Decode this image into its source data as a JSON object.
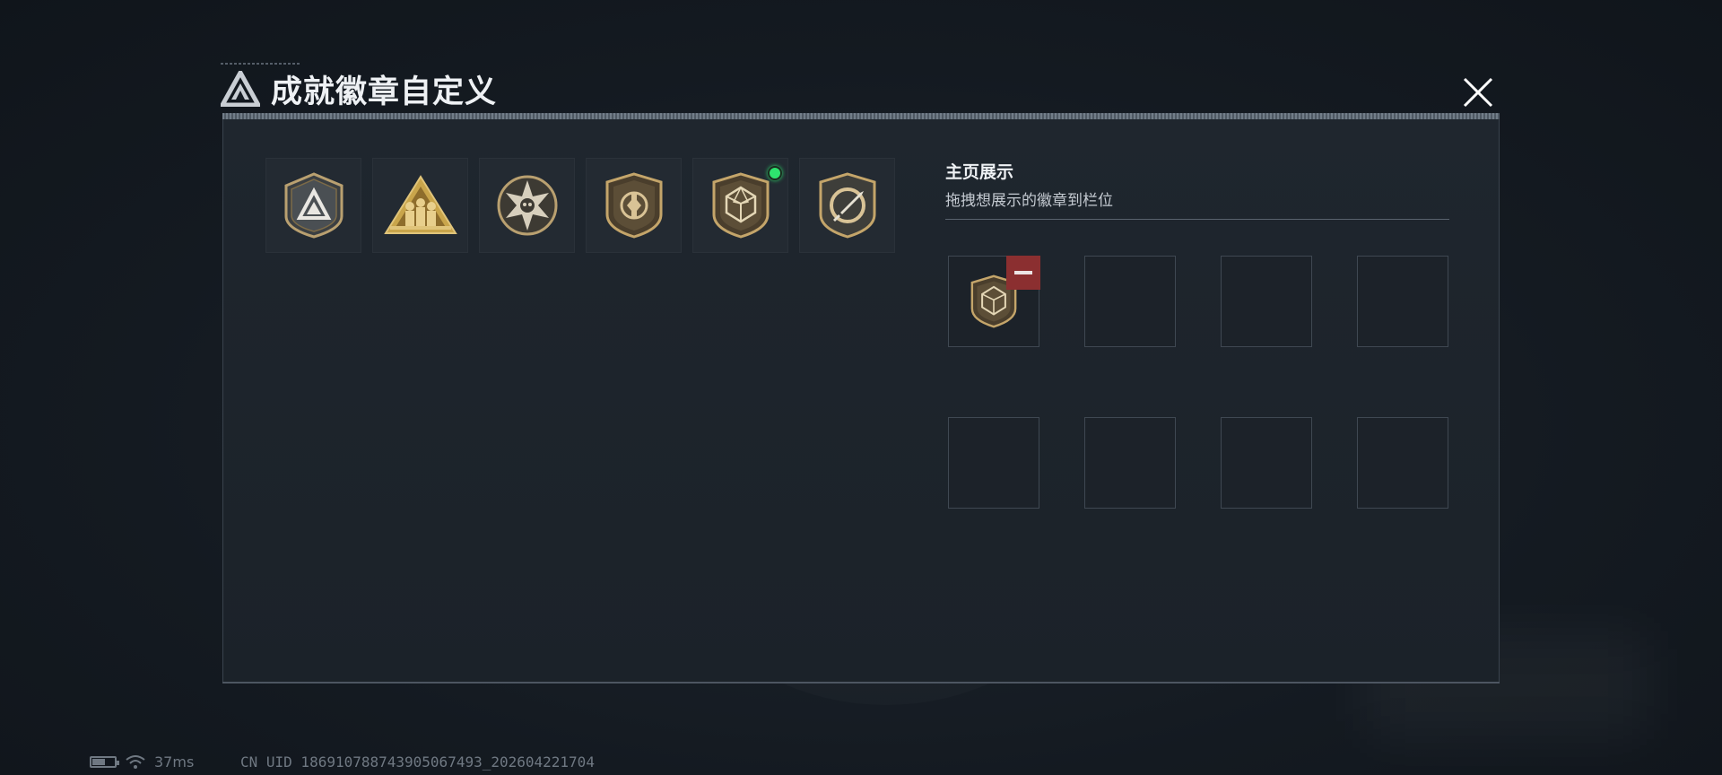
{
  "window": {
    "title": "成就徽章自定义",
    "close_icon": "close-icon"
  },
  "badges": [
    {
      "name": "shield-triangle-badge",
      "new": false
    },
    {
      "name": "soldiers-triangle-badge",
      "new": false
    },
    {
      "name": "star-skull-badge",
      "new": false
    },
    {
      "name": "shield-emblem-badge",
      "new": false
    },
    {
      "name": "polyhedron-shield-badge",
      "new": true
    },
    {
      "name": "crossed-knife-badge",
      "new": false
    }
  ],
  "showcase": {
    "title": "主页展示",
    "hint": "拖拽想展示的徽章到栏位",
    "slots": [
      {
        "badge": "polyhedron-shield-badge",
        "removable": true
      },
      {
        "badge": null
      },
      {
        "badge": null
      },
      {
        "badge": null
      },
      {
        "badge": null
      },
      {
        "badge": null
      },
      {
        "badge": null
      },
      {
        "badge": null
      }
    ]
  },
  "status": {
    "ping": "37ms",
    "uid": "CN UID 1869107887439050674​93_202604221704"
  },
  "colors": {
    "accent_gold": "#c9ad72",
    "new_indicator": "#2ee36e",
    "remove_red": "#8b2f30"
  }
}
